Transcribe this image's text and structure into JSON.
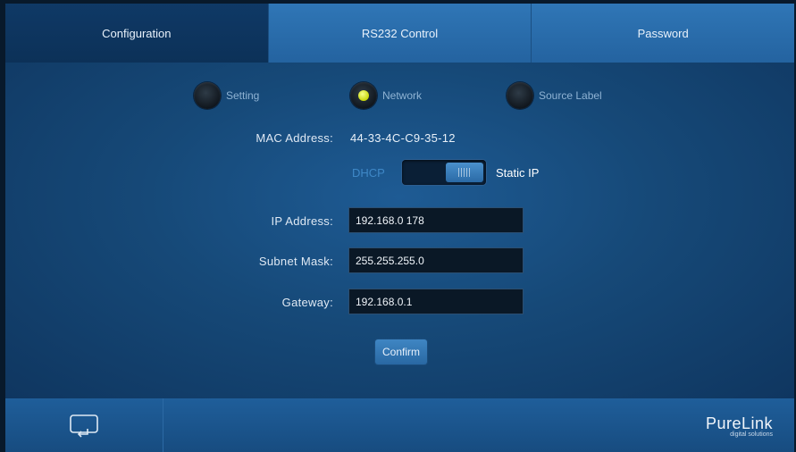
{
  "tabs": [
    {
      "label": "Configuration",
      "active": true
    },
    {
      "label": "RS232 Control",
      "active": false
    },
    {
      "label": "Password",
      "active": false
    }
  ],
  "radios": [
    {
      "label": "Setting",
      "selected": false
    },
    {
      "label": "Network",
      "selected": true
    },
    {
      "label": "Source Label",
      "selected": false
    }
  ],
  "mac": {
    "label": "MAC Address:",
    "value": "44-33-4C-C9-35-12"
  },
  "toggle": {
    "off_label": "DHCP",
    "on_label": "Static IP",
    "state": "Static IP"
  },
  "fields": {
    "ip": {
      "label": "IP Address:",
      "value": "192.168.0 178"
    },
    "subnet": {
      "label": "Subnet Mask:",
      "value": "255.255.255.0"
    },
    "gateway": {
      "label": "Gateway:",
      "value": "192.168.0.1"
    }
  },
  "confirm_label": "Confirm",
  "footer": {
    "brand": "PureLink",
    "tagline": "digital solutions"
  },
  "colors": {
    "accent": "#2f76b6",
    "active_tab": "#0f3966",
    "indicator": "#d4e21a"
  },
  "icons": {
    "screen": "screen-return-icon"
  }
}
